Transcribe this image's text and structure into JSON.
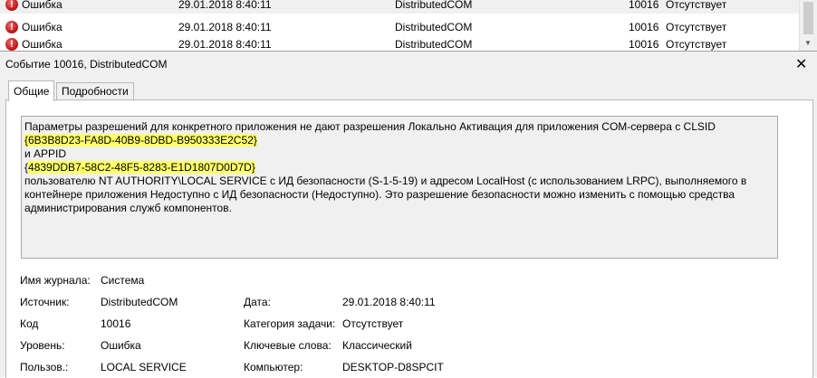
{
  "events": [
    {
      "level": "Ошибка",
      "datetime": "29.01.2018 8:40:11",
      "source": "DistributedCOM",
      "id": "10016",
      "category": "Отсутствует"
    },
    {
      "level": "Ошибка",
      "datetime": "29.01.2018 8:40:11",
      "source": "DistributedCOM",
      "id": "10016",
      "category": "Отсутствует"
    },
    {
      "level": "Ошибка",
      "datetime": "29.01.2018 8:40:11",
      "source": "DistributedCOM",
      "id": "10016",
      "category": "Отсутствует"
    }
  ],
  "detail": {
    "title": "Событие 10016, DistributedCOM",
    "close_glyph": "✕",
    "tabs": [
      "Общие",
      "Подробности"
    ],
    "description": {
      "line1": "Параметры разрешений для конкретного приложения не дают разрешения Локально Активация для приложения COM-сервера с CLSID",
      "clsid": "{6B3B8D23-FA8D-40B9-8DBD-B950333E2C52}",
      "line3": " и APPID ",
      "appid_open": "{",
      "appid": "4839DDB7-58C2-48F5-8283-E1D1807D0D7D}",
      "line5": " пользователю NT AUTHORITY\\LOCAL SERVICE с ИД безопасности (S-1-5-19) и адресом LocalHost (с использованием LRPC), выполняемого в контейнере приложения Недоступно с ИД безопасности (Недоступно). Это разрешение безопасности можно изменить с помощью средства администрирования служб компонентов."
    },
    "props": {
      "log_label": "Имя журнала:",
      "log_value": "Система",
      "source_label": "Источник:",
      "source_value": "DistributedCOM",
      "date_label": "Дата:",
      "date_value": "29.01.2018 8:40:11",
      "code_label": "Код",
      "code_value": "10016",
      "task_label": "Категория задачи:",
      "task_value": "Отсутствует",
      "level_label": "Уровень:",
      "level_value": "Ошибка",
      "keywords_label": "Ключевые слова:",
      "keywords_value": "Классический",
      "user_label": "Пользов.:",
      "user_value": "LOCAL SERVICE",
      "computer_label": "Компьютер:",
      "computer_value": "DESKTOP-D8SPCIT"
    }
  },
  "colors": {
    "highlight": "#ffff66",
    "error_red": "#c41a1a"
  }
}
